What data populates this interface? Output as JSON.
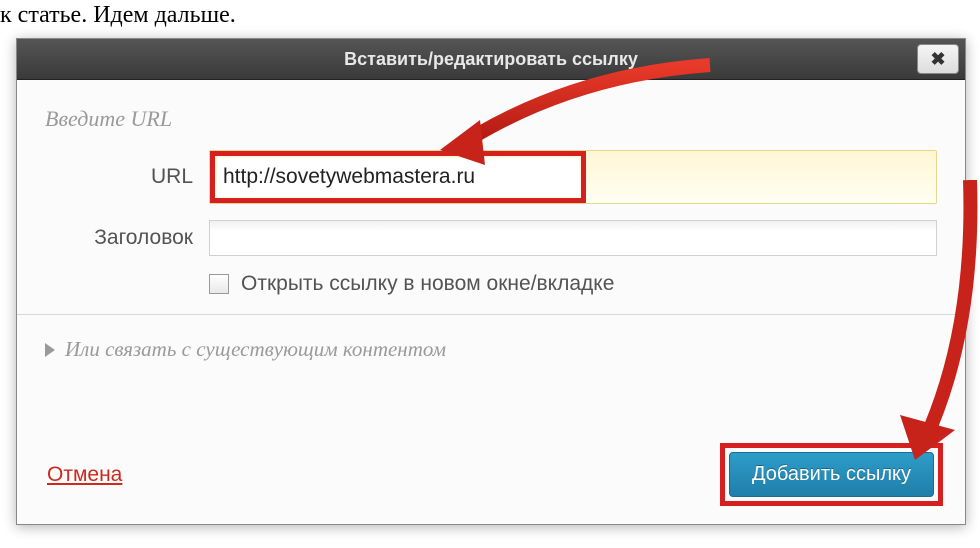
{
  "background": {
    "line1": "к статье. Идем дальше."
  },
  "dialog": {
    "title": "Вставить/редактировать ссылку",
    "section_label": "Введите URL",
    "url": {
      "label": "URL",
      "value": "http://sovetywebmastera.ru"
    },
    "title_field": {
      "label": "Заголовок",
      "value": ""
    },
    "checkbox_label": "Открыть ссылку в новом окне/вкладке",
    "expand_label": "Или связать с существующим контентом",
    "cancel": "Отмена",
    "add_link": "Добавить ссылку"
  }
}
